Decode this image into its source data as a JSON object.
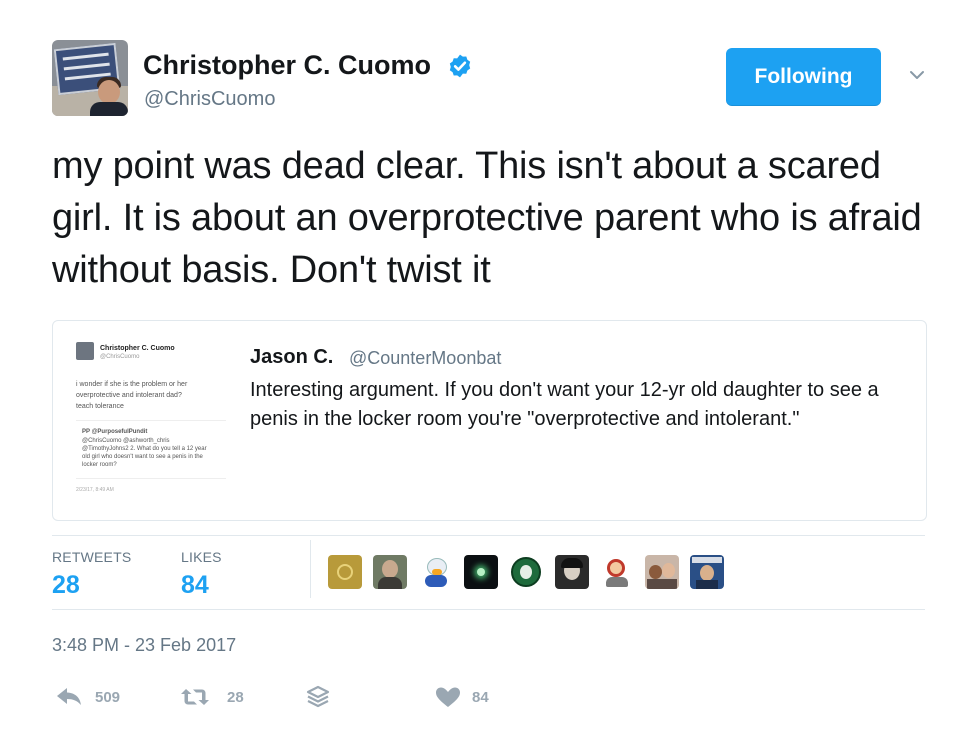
{
  "author": {
    "display_name": "Christopher C. Cuomo",
    "handle": "@ChrisCuomo",
    "verified": true,
    "avatar_icon": "profile-photo"
  },
  "follow_button": {
    "label": "Following",
    "color": "#1da1f2"
  },
  "tweet": {
    "text": "my point was dead clear. This isn't about a scared girl. It is about an overprotective parent who is afraid without basis. Don't twist it"
  },
  "quoted_tweet": {
    "author_name": "Jason C.",
    "author_handle": "@CounterMoonbat",
    "text": "Interesting argument. If you don't want your 12-yr old daughter to see a penis in the locker room you're \"overprotective and intolerant.\"",
    "thumbnail": {
      "name": "Christopher C. Cuomo",
      "handle": "@ChrisCuomo",
      "line1": "i wonder if she is the problem or her",
      "line2": "overprotective and intolerant dad?",
      "line3": "teach tolerance",
      "reply_head": "PP @PurposefulPundit",
      "reply1": "@ChrisCuomo @ashworth_chris",
      "reply2": "@TimothyJohns2 2. What do you tell a 12 year",
      "reply3": "old girl who doesn't want to see a penis in the",
      "reply4": "locker room?",
      "time": "2/23/17, 8:49 AM"
    }
  },
  "stats": {
    "retweets_label": "RETWEETS",
    "retweets_value": "28",
    "likes_label": "LIKES",
    "likes_value": "84"
  },
  "likers": [
    "liker-avatar-1",
    "liker-avatar-2",
    "liker-avatar-3",
    "liker-avatar-4",
    "liker-avatar-5",
    "liker-avatar-6",
    "liker-avatar-7",
    "liker-avatar-8",
    "liker-avatar-9"
  ],
  "timestamp": "3:48 PM - 23 Feb 2017",
  "actions": {
    "reply_count": "509",
    "retweet_count": "28",
    "like_count": "84",
    "icon_color": "#9aa7b2"
  }
}
